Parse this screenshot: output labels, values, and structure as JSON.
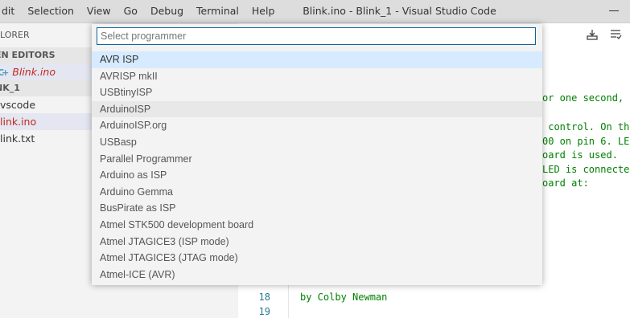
{
  "window": {
    "title": "Blink.ino - Blink_1 - Visual Studio Code"
  },
  "menu": [
    "dit",
    "Selection",
    "View",
    "Go",
    "Debug",
    "Terminal",
    "Help"
  ],
  "sidebar": {
    "header": "LORER",
    "open_editors_label": "EN EDITORS",
    "open_editors": [
      {
        "icon": "C",
        "label": "Blink.ino"
      }
    ],
    "folder_label": "NK_1",
    "files": [
      "vscode",
      "link.ino",
      "link.txt"
    ]
  },
  "editor": {
    "code_lines": [
      "or one second,",
      "",
      " control. On th",
      "00 on pin 6. LE",
      "oard is used.",
      "LED is connecte",
      "oard at:"
    ],
    "bottom_lines": [
      {
        "number": "18",
        "text": "by Colby Newman"
      },
      {
        "number": "19",
        "text": ""
      }
    ]
  },
  "quickpick": {
    "placeholder": "Select programmer",
    "items": [
      "AVR ISP",
      "AVRISP mkII",
      "USBtinyISP",
      "ArduinoISP",
      "ArduinoISP.org",
      "USBasp",
      "Parallel Programmer",
      "Arduino as ISP",
      "Arduino Gemma",
      "BusPirate as ISP",
      "Atmel STK500 development board",
      "Atmel JTAGICE3 (ISP mode)",
      "Atmel JTAGICE3 (JTAG mode)",
      "Atmel-ICE (AVR)"
    ]
  }
}
